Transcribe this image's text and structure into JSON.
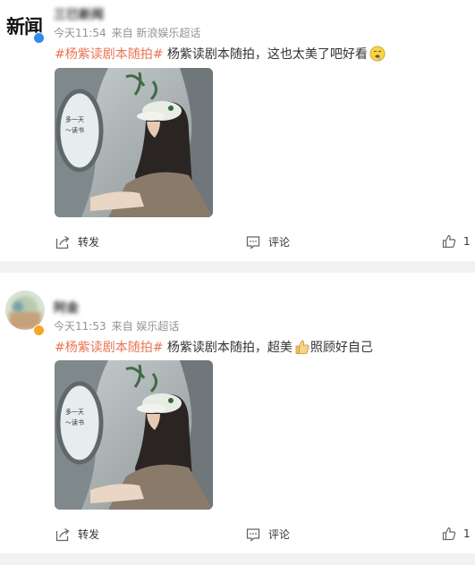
{
  "colors": {
    "tag": "#eb7350",
    "meta": "#939393",
    "text": "#333333",
    "separator": "#f2f2f2",
    "verified_badge": "#2d8cf0"
  },
  "posts": [
    {
      "avatar_label": "新闻",
      "username": "三已新闻",
      "time": "今天11:54",
      "source": "来自 新浪娱乐超话",
      "hashtag": "#杨紫读剧本随拍#",
      "body": " 杨紫读剧本随拍，这也太美了吧好看",
      "emoji": "drool-face-emoji",
      "actions": {
        "repost": "转发",
        "comment": "评论",
        "like_count": "1"
      }
    },
    {
      "avatar_label": "",
      "username": "阿金",
      "time": "今天11:53",
      "source": "来自 娱乐超话",
      "hashtag": "#杨紫读剧本随拍#",
      "body": " 杨紫读剧本随拍，超美",
      "emoji": "thumbs-up-emoji",
      "body_after_emoji": "照顾好自己",
      "actions": {
        "repost": "转发",
        "comment": "评论",
        "like_count": "1"
      }
    }
  ]
}
